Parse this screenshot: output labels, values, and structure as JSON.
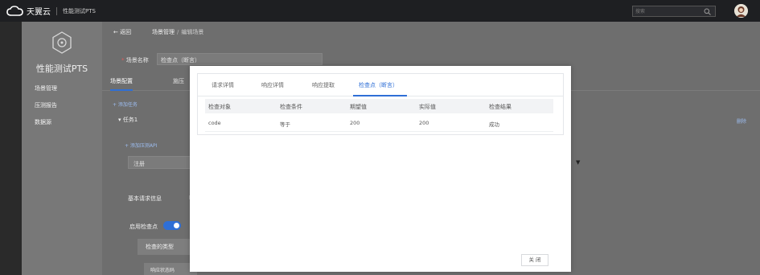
{
  "topbar": {
    "brand": "天翼云",
    "product": "性能测试PTS",
    "search_placeholder": "搜索"
  },
  "sidebar": {
    "title": "性能测试PTS",
    "items": [
      {
        "label": "场景管理"
      },
      {
        "label": "压测报告"
      },
      {
        "label": "数据源"
      }
    ]
  },
  "main": {
    "back_label": "返回",
    "breadcrumb": {
      "parent": "场景管理",
      "separator": "/",
      "current": "编辑场景"
    },
    "scene_name_label": "场景名称",
    "scene_name_value": "检查点（断言）",
    "tabs": {
      "scene_config": "场景配置",
      "press_config": "施压"
    },
    "add_task": "+ 添加任务",
    "task_label": "任务1",
    "delete_label": "删除",
    "add_api": "+ 添加压测API",
    "api_value": "注册",
    "basic_info": "基本请求信息",
    "basic_sep": "I",
    "enable_check": "启用检查点",
    "check_type": "检查的类型",
    "resp_code": "响应状态码"
  },
  "modal": {
    "tabs": [
      "请求详情",
      "响应详情",
      "响应提取",
      "检查点（断言）"
    ],
    "active_tab": 3,
    "columns": [
      "检查对象",
      "检查条件",
      "期望值",
      "实际值",
      "检查结果"
    ],
    "rows": [
      [
        "code",
        "等于",
        "200",
        "200",
        "成功"
      ]
    ],
    "close_label": "关 闭"
  },
  "colors": {
    "accent": "#2f6fd6",
    "topbar": "#1e1f22",
    "overlay": "#6e6e6e"
  }
}
